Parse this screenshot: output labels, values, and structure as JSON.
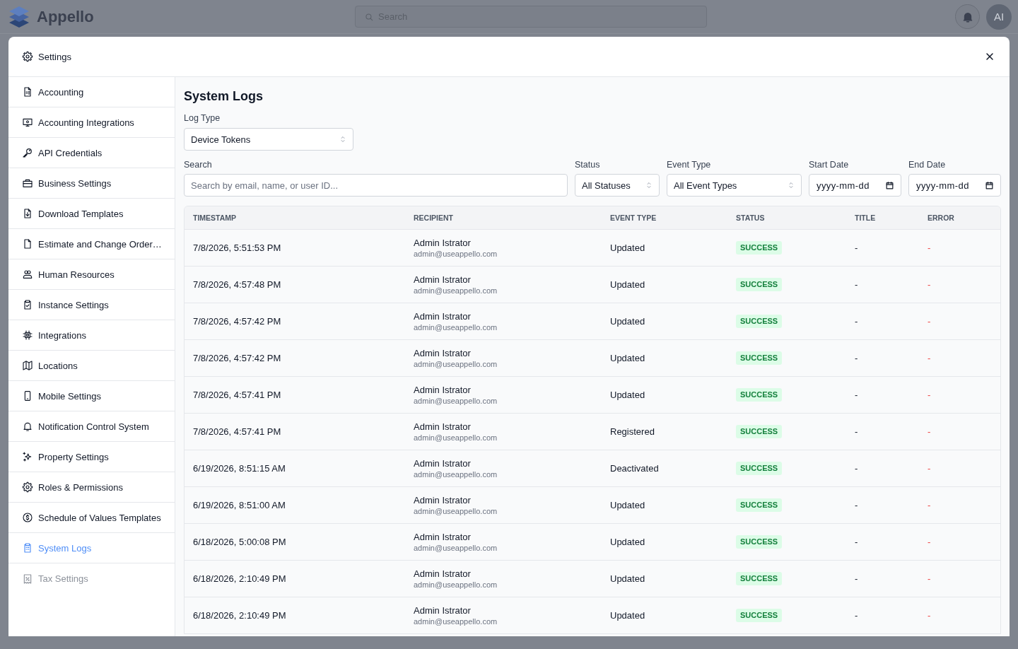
{
  "app_bar": {
    "brand": "Appello",
    "search": {
      "placeholder": "Search"
    },
    "avatar": "AI"
  },
  "dialog": {
    "title": "Settings",
    "sidebar": {
      "items": [
        {
          "label": "Accounting",
          "selected": false,
          "disabled": false
        },
        {
          "label": "Accounting Integrations",
          "selected": false,
          "disabled": false
        },
        {
          "label": "API Credentials",
          "selected": false,
          "disabled": false
        },
        {
          "label": "Business Settings",
          "selected": false,
          "disabled": false
        },
        {
          "label": "Download Templates",
          "selected": false,
          "disabled": false
        },
        {
          "label": "Estimate and Change Order…",
          "selected": false,
          "disabled": false
        },
        {
          "label": "Human Resources",
          "selected": false,
          "disabled": false
        },
        {
          "label": "Instance Settings",
          "selected": false,
          "disabled": false
        },
        {
          "label": "Integrations",
          "selected": false,
          "disabled": false
        },
        {
          "label": "Locations",
          "selected": false,
          "disabled": false
        },
        {
          "label": "Mobile Settings",
          "selected": false,
          "disabled": false
        },
        {
          "label": "Notification Control System",
          "selected": false,
          "disabled": false
        },
        {
          "label": "Property Settings",
          "selected": false,
          "disabled": false
        },
        {
          "label": "Roles & Permissions",
          "selected": false,
          "disabled": false
        },
        {
          "label": "Schedule of Values Templates",
          "selected": false,
          "disabled": false
        },
        {
          "label": "System Logs",
          "selected": true,
          "disabled": false
        },
        {
          "label": "Tax Settings",
          "selected": false,
          "disabled": true
        }
      ]
    },
    "content": {
      "title": "System Logs",
      "log_type": {
        "label": "Log Type",
        "value": "Device Tokens"
      },
      "filters": {
        "search": {
          "label": "Search",
          "placeholder": "Search by email, name, or user ID..."
        },
        "status": {
          "label": "Status",
          "value": "All Statuses"
        },
        "event_type": {
          "label": "Event Type",
          "value": "All Event Types"
        },
        "start_date": {
          "label": "Start Date",
          "placeholder": "yyyy-mm-dd"
        },
        "end_date": {
          "label": "End Date",
          "placeholder": "yyyy-mm-dd"
        }
      },
      "table": {
        "columns": [
          "TIMESTAMP",
          "RECIPIENT",
          "EVENT TYPE",
          "STATUS",
          "TITLE",
          "ERROR"
        ],
        "rows": [
          {
            "timestamp": "7/8/2026, 5:51:53 PM",
            "recipient_name": "Admin Istrator",
            "recipient_email": "admin@useappello.com",
            "event_type": "Updated",
            "status": "SUCCESS",
            "title": "-",
            "error": "-"
          },
          {
            "timestamp": "7/8/2026, 4:57:48 PM",
            "recipient_name": "Admin Istrator",
            "recipient_email": "admin@useappello.com",
            "event_type": "Updated",
            "status": "SUCCESS",
            "title": "-",
            "error": "-"
          },
          {
            "timestamp": "7/8/2026, 4:57:42 PM",
            "recipient_name": "Admin Istrator",
            "recipient_email": "admin@useappello.com",
            "event_type": "Updated",
            "status": "SUCCESS",
            "title": "-",
            "error": "-"
          },
          {
            "timestamp": "7/8/2026, 4:57:42 PM",
            "recipient_name": "Admin Istrator",
            "recipient_email": "admin@useappello.com",
            "event_type": "Updated",
            "status": "SUCCESS",
            "title": "-",
            "error": "-"
          },
          {
            "timestamp": "7/8/2026, 4:57:41 PM",
            "recipient_name": "Admin Istrator",
            "recipient_email": "admin@useappello.com",
            "event_type": "Updated",
            "status": "SUCCESS",
            "title": "-",
            "error": "-"
          },
          {
            "timestamp": "7/8/2026, 4:57:41 PM",
            "recipient_name": "Admin Istrator",
            "recipient_email": "admin@useappello.com",
            "event_type": "Registered",
            "status": "SUCCESS",
            "title": "-",
            "error": "-"
          },
          {
            "timestamp": "6/19/2026, 8:51:15 AM",
            "recipient_name": "Admin Istrator",
            "recipient_email": "admin@useappello.com",
            "event_type": "Deactivated",
            "status": "SUCCESS",
            "title": "-",
            "error": "-"
          },
          {
            "timestamp": "6/19/2026, 8:51:00 AM",
            "recipient_name": "Admin Istrator",
            "recipient_email": "admin@useappello.com",
            "event_type": "Updated",
            "status": "SUCCESS",
            "title": "-",
            "error": "-"
          },
          {
            "timestamp": "6/18/2026, 5:00:08 PM",
            "recipient_name": "Admin Istrator",
            "recipient_email": "admin@useappello.com",
            "event_type": "Updated",
            "status": "SUCCESS",
            "title": "-",
            "error": "-"
          },
          {
            "timestamp": "6/18/2026, 2:10:49 PM",
            "recipient_name": "Admin Istrator",
            "recipient_email": "admin@useappello.com",
            "event_type": "Updated",
            "status": "SUCCESS",
            "title": "-",
            "error": "-"
          },
          {
            "timestamp": "6/18/2026, 2:10:49 PM",
            "recipient_name": "Admin Istrator",
            "recipient_email": "admin@useappello.com",
            "event_type": "Updated",
            "status": "SUCCESS",
            "title": "-",
            "error": "-"
          }
        ]
      }
    }
  }
}
